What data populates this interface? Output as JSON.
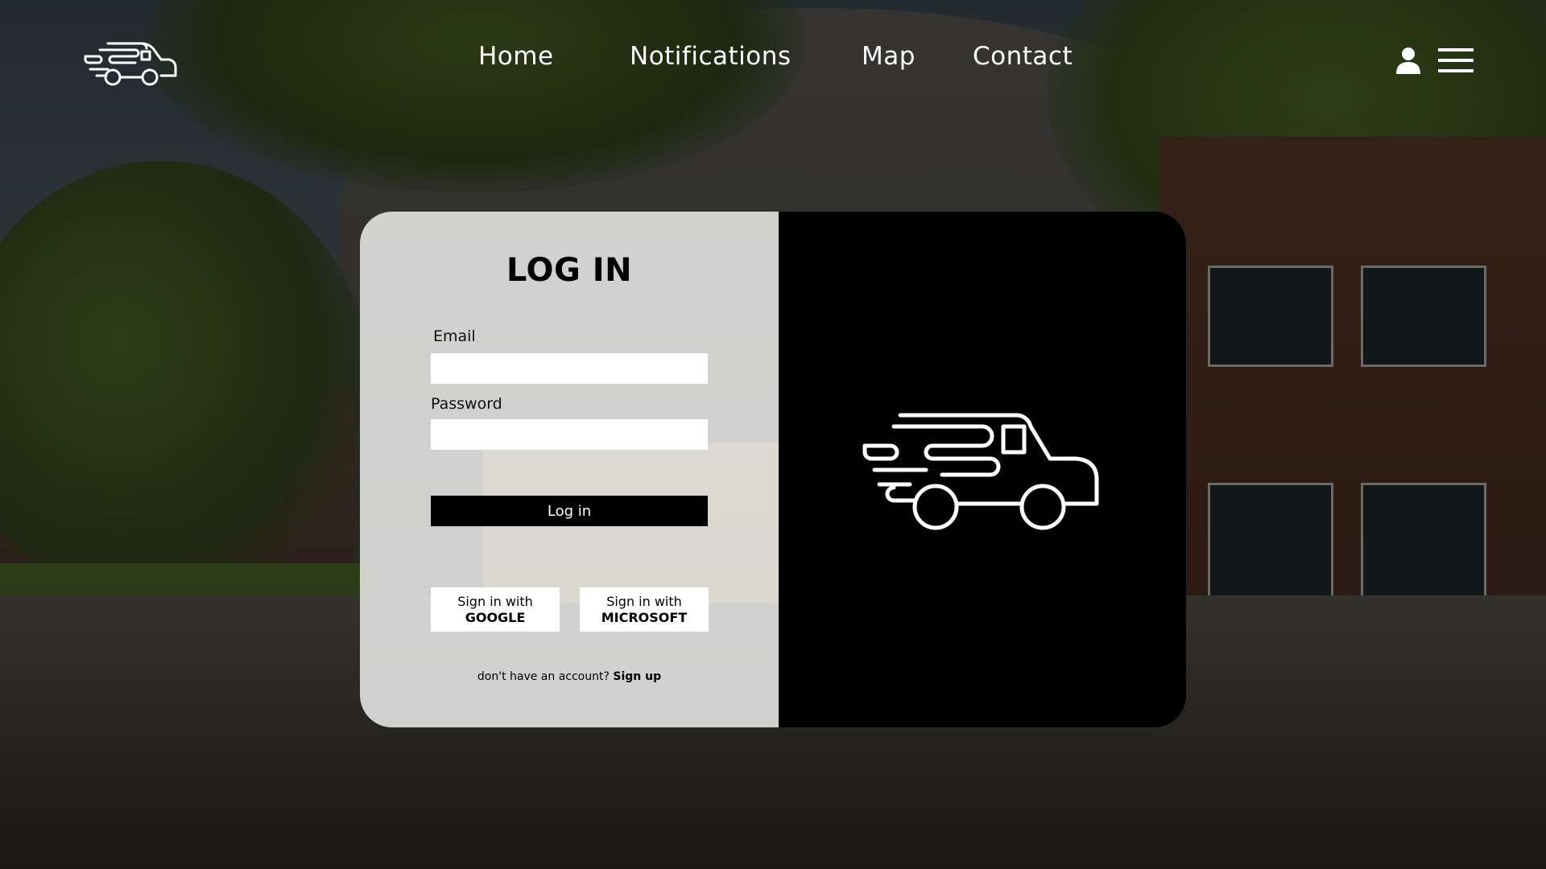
{
  "nav": {
    "items": [
      {
        "label": "Home"
      },
      {
        "label": "Notifications"
      },
      {
        "label": "Map"
      },
      {
        "label": "Contact"
      }
    ]
  },
  "login": {
    "title": "LOG IN",
    "email_label": "Email",
    "email_value": "",
    "password_label": "Password",
    "password_value": "",
    "submit_label": "Log in",
    "google": {
      "line1": "Sign in with",
      "line2": "GOOGLE"
    },
    "microsoft": {
      "line1": "Sign in with",
      "line2": "MICROSOFT"
    },
    "signup_prompt": "don't have an account?",
    "signup_link": "Sign up"
  },
  "icons": {
    "logo": "bus-logo-icon",
    "user": "user-icon",
    "menu": "hamburger-menu-icon"
  },
  "colors": {
    "text_light": "#ffffff",
    "card_left_bg": "#ececec",
    "card_right_bg": "#000000",
    "button_bg": "#000000"
  }
}
